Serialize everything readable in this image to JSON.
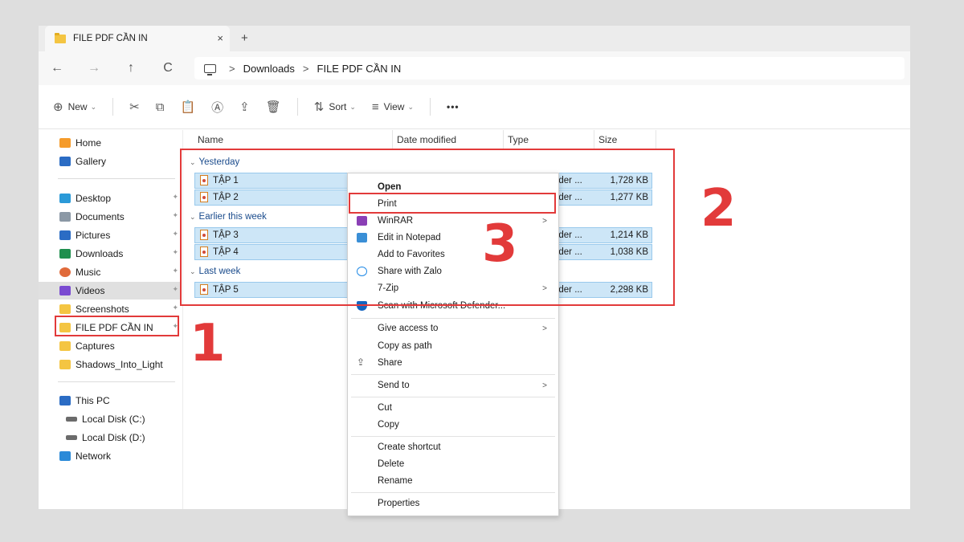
{
  "window": {
    "tab_title": "FILE PDF CẦN IN",
    "tab_close": "×",
    "tab_new": "+"
  },
  "nav": {
    "back": "←",
    "forward": "→",
    "up": "↑",
    "refresh": "C",
    "breadcrumb": [
      "Downloads",
      "FILE PDF CẦN IN"
    ],
    "separator": ">"
  },
  "toolbar": {
    "new": "New",
    "sort": "Sort",
    "view": "View",
    "more": "•••"
  },
  "sidebar": {
    "items": [
      {
        "label": "Home",
        "color": "#f59b2a",
        "pinned": false
      },
      {
        "label": "Gallery",
        "color": "#2b6cc4",
        "pinned": false
      },
      {
        "label": "Desktop",
        "color": "#2b9ad8",
        "pinned": true
      },
      {
        "label": "Documents",
        "color": "#8b98a5",
        "pinned": true
      },
      {
        "label": "Pictures",
        "color": "#2b6cc4",
        "pinned": true
      },
      {
        "label": "Downloads",
        "color": "#1f8f4e",
        "pinned": true
      },
      {
        "label": "Music",
        "color": "#e06a3a",
        "pinned": true
      },
      {
        "label": "Videos",
        "color": "#7a4bd1",
        "pinned": true
      },
      {
        "label": "Screenshots",
        "color": "#f4c542",
        "pinned": true
      },
      {
        "label": "FILE PDF CẦN IN",
        "color": "#f4c542",
        "pinned": true
      },
      {
        "label": "Captures",
        "color": "#f4c542",
        "pinned": false
      },
      {
        "label": "Shadows_Into_Light",
        "color": "#f4c542",
        "pinned": false
      },
      {
        "label": "This PC",
        "color": "#2b6cc4",
        "pinned": false
      },
      {
        "label": "Local Disk (C:)",
        "color": "#6b6b6b",
        "pinned": false
      },
      {
        "label": "Local Disk (D:)",
        "color": "#6b6b6b",
        "pinned": false
      },
      {
        "label": "Network",
        "color": "#2b8ad8",
        "pinned": false
      }
    ]
  },
  "columns": {
    "name": "Name",
    "date": "Date modified",
    "type": "Type",
    "size": "Size"
  },
  "groups": {
    "yesterday": "Yesterday",
    "earlier": "Earlier this week",
    "last_week": "Last week"
  },
  "files": [
    {
      "name": "TẬP 1",
      "type": "ader ...",
      "size": "1,728 KB"
    },
    {
      "name": "TẬP 2",
      "type": "ader ...",
      "size": "1,277 KB"
    },
    {
      "name": "TẬP 3",
      "type": "ader ...",
      "size": "1,214 KB"
    },
    {
      "name": "TẬP 4",
      "type": "ader ...",
      "size": "1,038 KB"
    },
    {
      "name": "TẬP 5",
      "type": "ader ...",
      "size": "2,298 KB"
    }
  ],
  "context_menu": {
    "open": "Open",
    "print": "Print",
    "winrar": "WinRAR",
    "notepad": "Edit in Notepad",
    "favorites": "Add to Favorites",
    "zalo": "Share with Zalo",
    "zip": "7-Zip",
    "defender": "Scan with Microsoft Defender...",
    "give_access": "Give access to",
    "copy_path": "Copy as path",
    "share": "Share",
    "send_to": "Send to",
    "cut": "Cut",
    "copy": "Copy",
    "shortcut": "Create shortcut",
    "delete": "Delete",
    "rename": "Rename",
    "properties": "Properties",
    "submenu_arrow": ">"
  },
  "annotations": {
    "step1": "1",
    "step2": "2",
    "step3": "3",
    "color": "#e23a3a"
  }
}
